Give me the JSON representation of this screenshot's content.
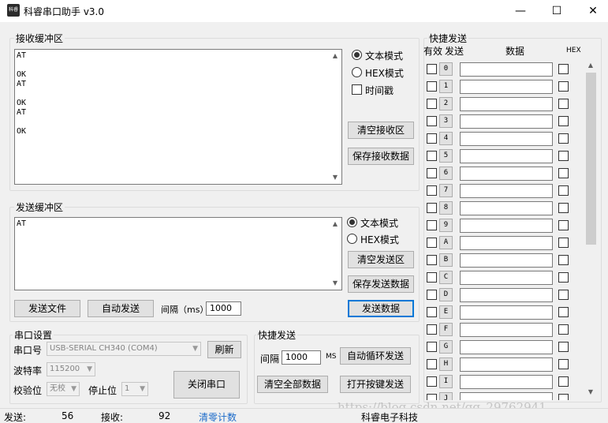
{
  "window": {
    "title": "科睿串口助手 v3.0",
    "icon_text": "科睿",
    "minimize_glyph": "—",
    "maximize_glyph": "☐",
    "close_glyph": "✕"
  },
  "receive": {
    "group_title": "接收缓冲区",
    "content": "AT\n\nOK\nAT\n\nOK\nAT\n\nOK",
    "mode_text": "文本模式",
    "mode_hex": "HEX模式",
    "timestamp": "时间戳",
    "clear_button": "清空接收区",
    "save_button": "保存接收数据"
  },
  "send": {
    "group_title": "发送缓冲区",
    "content": "AT",
    "mode_text": "文本模式",
    "mode_hex": "HEX模式",
    "clear_button": "清空发送区",
    "save_button": "保存发送数据",
    "send_file_button": "发送文件",
    "auto_send_button": "自动发送",
    "interval_label": "间隔（ms）",
    "interval_value": "1000",
    "send_data_button": "发送数据"
  },
  "serial": {
    "group_title": "串口设置",
    "port_label": "串口号",
    "port_value": "USB-SERIAL CH340 (COM4)",
    "refresh_button": "刷新",
    "baud_label": "波特率",
    "baud_value": "115200",
    "parity_label": "校验位",
    "parity_value": "无校",
    "stopbits_label": "停止位",
    "stopbits_value": "1",
    "close_port_button": "关闭串口"
  },
  "quick_bottom": {
    "group_title": "快捷发送",
    "interval_label": "间隔",
    "interval_value": "1000",
    "unit": "MS",
    "auto_loop_button": "自动循环发送",
    "clear_all_button": "清空全部数据",
    "open_keys_button": "打开按键发送"
  },
  "quick_list": {
    "group_title": "快捷发送",
    "col_enable": "有效",
    "col_send": "发送",
    "col_data": "数据",
    "col_hex": "HEX",
    "rows": [
      "0",
      "1",
      "2",
      "3",
      "4",
      "5",
      "6",
      "7",
      "8",
      "9",
      "A",
      "B",
      "C",
      "D",
      "E",
      "F",
      "G",
      "H",
      "I",
      "J"
    ]
  },
  "status": {
    "sent_label": "发送:",
    "sent_count": "56",
    "recv_label": "接收:",
    "recv_count": "92",
    "reset_link": "清零计数",
    "company": "科睿电子科技"
  },
  "watermark": "https://blog.csdn.net/qq_29762941",
  "colors": {
    "accent": "#0078d7",
    "link": "#1b6ac9"
  }
}
